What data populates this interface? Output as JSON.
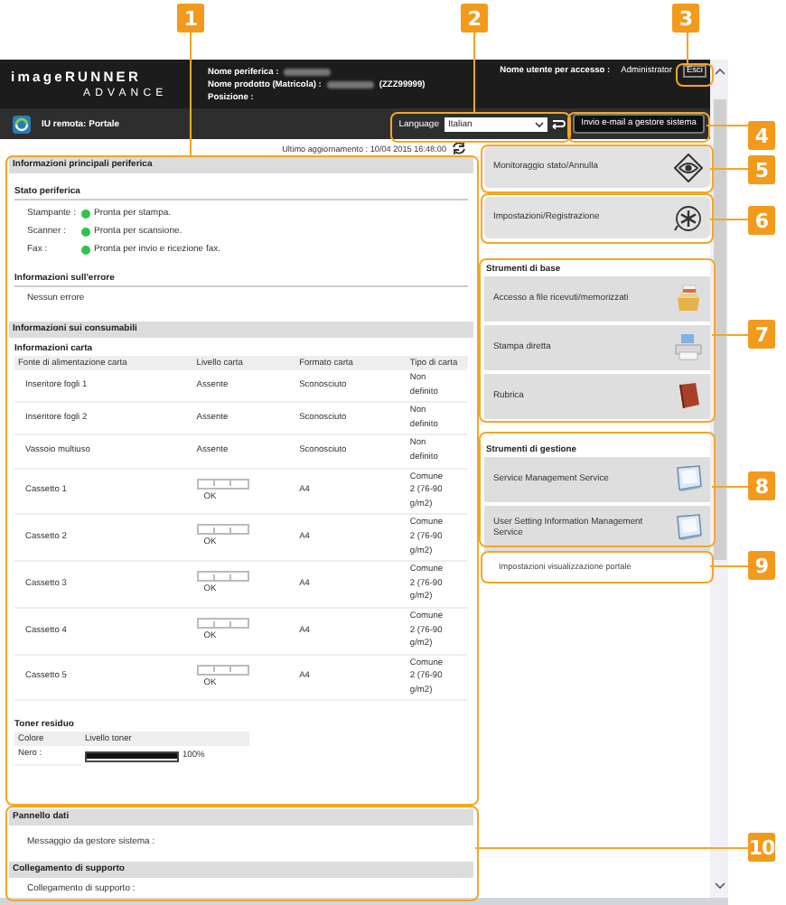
{
  "callouts": [
    "1",
    "2",
    "3",
    "4",
    "5",
    "6",
    "7",
    "8",
    "9",
    "10"
  ],
  "header": {
    "logo_top": "imageRUNNER",
    "logo_bottom": "ADVANCE",
    "device_fields": [
      {
        "label": "Nome periferica :",
        "redacted": true
      },
      {
        "label": "Nome prodotto (Matricola) :",
        "redacted": true,
        "value": "(ZZZ99999)"
      },
      {
        "label": "Posizione :",
        "redacted": false
      }
    ],
    "user_label": "Nome utente per accesso :",
    "user_name": "Administrator",
    "logout_button": "Esci"
  },
  "toolbar": {
    "title": "IU remota: Portale",
    "language_label": "Language",
    "language_value": "Italian",
    "email_button": "Invio e-mail a gestore sistema"
  },
  "last_update": "Ultimo aggiornamento : 10/04 2015 16:48:00",
  "device_info": {
    "title": "Informazioni principali periferica",
    "status_title": "Stato periferica",
    "status": [
      {
        "label": "Stampante :",
        "text": "Pronta per stampa.",
        "color": "#2ec44f"
      },
      {
        "label": "Scanner :",
        "text": "Pronta per scansione.",
        "color": "#2ec44f"
      },
      {
        "label": "Fax :",
        "text": "Pronta per invio e ricezione fax.",
        "color": "#2ec44f"
      }
    ],
    "error_title": "Informazioni sull'errore",
    "error_text": "Nessun errore"
  },
  "consumables": {
    "title": "Informazioni sui consumabili",
    "paper_title": "Informazioni carta",
    "columns": [
      "Fonte di alimentazione carta",
      "Livello carta",
      "Formato carta",
      "Tipo di carta"
    ],
    "rows": [
      {
        "kind": "text",
        "source": "Inseritore fogli 1",
        "paper_level": "Assente",
        "size": "Sconosciuto",
        "type": "Non definito"
      },
      {
        "kind": "text",
        "source": "Inseritore fogli 2",
        "paper_level": "Assente",
        "size": "Sconosciuto",
        "type": "Non definito"
      },
      {
        "kind": "text",
        "source": "Vassoio multiuso",
        "paper_level": "Assente",
        "size": "Sconosciuto",
        "type": "Non definito"
      },
      {
        "kind": "gauge",
        "source": "Cassetto 1",
        "paper_level": "OK",
        "size": "A4",
        "type": "Comune 2 (76-90 g/m2)"
      },
      {
        "kind": "gauge",
        "source": "Cassetto 2",
        "paper_level": "OK",
        "size": "A4",
        "type": "Comune 2 (76-90 g/m2)"
      },
      {
        "kind": "gauge",
        "source": "Cassetto 3",
        "paper_level": "OK",
        "size": "A4",
        "type": "Comune 2 (76-90 g/m2)"
      },
      {
        "kind": "gauge",
        "source": "Cassetto 4",
        "paper_level": "OK",
        "size": "A4",
        "type": "Comune 2 (76-90 g/m2)"
      },
      {
        "kind": "gauge",
        "source": "Cassetto 5",
        "paper_level": "OK",
        "size": "A4",
        "type": "Comune 2 (76-90 g/m2)"
      }
    ],
    "toner_title": "Toner residuo",
    "toner_columns": [
      "Colore",
      "Livello toner"
    ],
    "toner_rows": [
      {
        "color_name": "Nero :",
        "level": 1,
        "reading": "100%"
      }
    ]
  },
  "data_panel": {
    "title": "Pannello dati",
    "message_label": "Messaggio da gestore sistema :"
  },
  "support": {
    "title": "Collegamento di supporto",
    "link_label": "Collegamento di supporto :"
  },
  "side": {
    "main_buttons": [
      "Monitoraggio stato/Annulla",
      "Impostazioni/Registrazione"
    ],
    "basic_tools": {
      "title": "Strumenti di base",
      "items": [
        "Accesso a file ricevuti/memorizzati",
        "Stampa diretta",
        "Rubrica"
      ]
    },
    "management_tools": {
      "title": "Strumenti di gestione",
      "items": [
        "Service Management Service",
        "User Setting Information Management Service"
      ]
    },
    "portal_settings": "Impostazioni visualizzazione portale"
  }
}
